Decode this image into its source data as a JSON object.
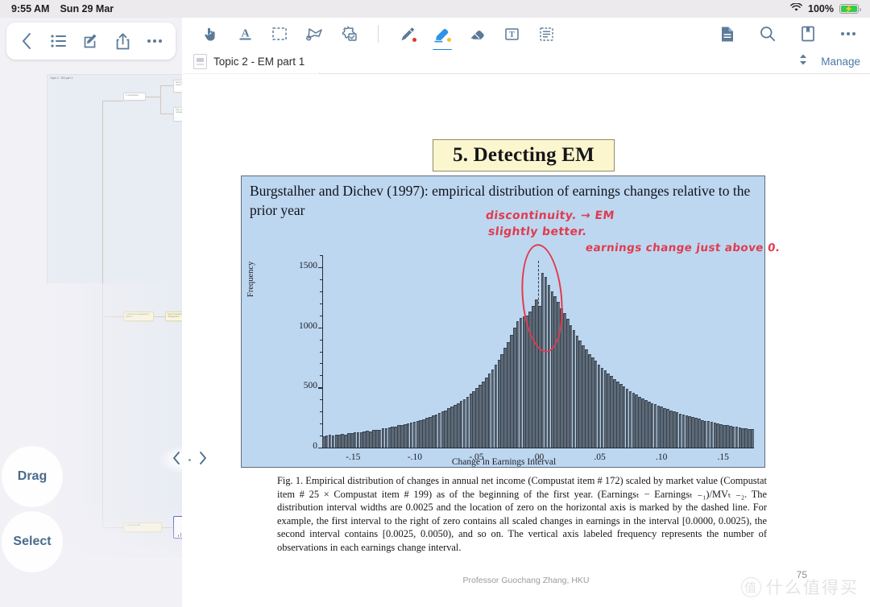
{
  "statusbar": {
    "time": "9:55 AM",
    "date": "Sun 29 Mar",
    "wifi_icon": "wifi-icon",
    "battery_percent": "100%",
    "battery_icon": "battery-charging-icon"
  },
  "left_toolbar": {
    "items": [
      {
        "name": "back-button",
        "icon": "chevron-left-icon"
      },
      {
        "name": "list-button",
        "icon": "bulleted-list-icon"
      },
      {
        "name": "edit-button",
        "icon": "compose-icon"
      },
      {
        "name": "share-button",
        "icon": "share-icon"
      },
      {
        "name": "more-button",
        "icon": "ellipsis-icon"
      }
    ]
  },
  "left_panel": {
    "mindmap_title": "Topic 2 - EM part 1",
    "drag_label": "Drag",
    "select_label": "Select",
    "nav_prev_icon": "chevron-left-icon",
    "nav_next_icon": "chevron-right-icon"
  },
  "doc_toolbar": {
    "left_tools": [
      {
        "name": "hand-tool",
        "icon": "hand-pointer-icon",
        "active": false
      },
      {
        "name": "text-underline-tool",
        "icon": "text-underline-icon",
        "active": false
      },
      {
        "name": "select-rectangle-tool",
        "icon": "selection-rectangle-icon",
        "active": false
      },
      {
        "name": "lasso-tool",
        "icon": "lasso-icon",
        "active": false
      },
      {
        "name": "shape-tool",
        "icon": "shape-settings-icon",
        "active": false
      },
      {
        "name": "pen-tool",
        "icon": "pen-icon",
        "active": false,
        "color": "#e5342f"
      },
      {
        "name": "highlighter-tool",
        "icon": "highlighter-icon",
        "active": true,
        "color": "#f2c230"
      },
      {
        "name": "eraser-tool",
        "icon": "eraser-icon",
        "active": false
      },
      {
        "name": "text-box-tool",
        "icon": "text-box-icon",
        "active": false
      },
      {
        "name": "note-tool",
        "icon": "sticky-note-icon",
        "active": false
      }
    ],
    "right_tools": [
      {
        "name": "page-view-button",
        "icon": "document-page-icon"
      },
      {
        "name": "search-button",
        "icon": "search-icon"
      },
      {
        "name": "bookmark-button",
        "icon": "bookmark-icon"
      },
      {
        "name": "more-options-button",
        "icon": "ellipsis-icon"
      }
    ]
  },
  "tabbar": {
    "tabs": [
      {
        "label": "Topic 2 - EM part 1",
        "thumb_icon": "document-thumbnail-icon"
      }
    ],
    "sort_icon": "up-down-chevron-icon",
    "manage_label": "Manage"
  },
  "slide": {
    "title": "5. Detecting EM",
    "headline": "Burgstalher and Dichev (1997): empirical distribution of earnings changes relative to the prior year",
    "annotations": [
      "discontinuity. → EM",
      "slightly better.",
      "earnings change just above 0."
    ],
    "caption": "Fig. 1.  Empirical distribution of changes in annual net income (Compustat item  # 172) scaled by market value (Compustat item  # 25 × Compustat item  # 199) as of the beginning of the first year. (Earningsₜ − Earningsₜ ₋₁)/MVₜ ₋₂. The distribution interval widths are 0.0025 and the location of zero on the horizontal axis is marked by the dashed line. For example, the first interval to the right of zero contains all scaled changes in earnings in the interval [0.0000, 0.0025), the second interval contains [0.0025, 0.0050), and so on. The vertical axis labeled frequency represents the number of observations in each earnings change interval.",
    "footer": "Professor Guochang Zhang, HKU",
    "page_number": "75"
  },
  "watermark": {
    "mark": "值",
    "text": "什么值得买"
  },
  "chart_data": {
    "type": "bar",
    "title": "",
    "xlabel": "Change in Earnings Interval",
    "ylabel": "Frequency",
    "xticks": [
      "-.15",
      "-.10",
      "-.05",
      ".00",
      ".05",
      ".10",
      ".15"
    ],
    "xtick_values": [
      -0.15,
      -0.1,
      -0.05,
      0.0,
      0.05,
      0.1,
      0.15
    ],
    "yticks": [
      "0",
      "500",
      "1000",
      "1500"
    ],
    "ytick_values": [
      0,
      500,
      1000,
      1500
    ],
    "xlim": [
      -0.175,
      0.175
    ],
    "ylim": [
      0,
      1600
    ],
    "grid": false,
    "legend": false,
    "zero_marker": "dashed line at x = 0.00",
    "bin_width": 0.0025,
    "x": [
      -0.1725,
      -0.17,
      -0.1675,
      -0.165,
      -0.1625,
      -0.16,
      -0.1575,
      -0.155,
      -0.1525,
      -0.15,
      -0.1475,
      -0.145,
      -0.1425,
      -0.14,
      -0.1375,
      -0.135,
      -0.1325,
      -0.13,
      -0.1275,
      -0.125,
      -0.1225,
      -0.12,
      -0.1175,
      -0.115,
      -0.1125,
      -0.11,
      -0.1075,
      -0.105,
      -0.1025,
      -0.1,
      -0.0975,
      -0.095,
      -0.0925,
      -0.09,
      -0.0875,
      -0.085,
      -0.0825,
      -0.08,
      -0.0775,
      -0.075,
      -0.0725,
      -0.07,
      -0.0675,
      -0.065,
      -0.0625,
      -0.06,
      -0.0575,
      -0.055,
      -0.0525,
      -0.05,
      -0.0475,
      -0.045,
      -0.0425,
      -0.04,
      -0.0375,
      -0.035,
      -0.0325,
      -0.03,
      -0.0275,
      -0.025,
      -0.0225,
      -0.02,
      -0.0175,
      -0.015,
      -0.0125,
      -0.01,
      -0.0075,
      -0.005,
      -0.0025,
      0.0,
      0.0025,
      0.005,
      0.0075,
      0.01,
      0.0125,
      0.015,
      0.0175,
      0.02,
      0.0225,
      0.025,
      0.0275,
      0.03,
      0.0325,
      0.035,
      0.0375,
      0.04,
      0.0425,
      0.045,
      0.0475,
      0.05,
      0.0525,
      0.055,
      0.0575,
      0.06,
      0.0625,
      0.065,
      0.0675,
      0.07,
      0.0725,
      0.075,
      0.0775,
      0.08,
      0.0825,
      0.085,
      0.0875,
      0.09,
      0.0925,
      0.095,
      0.0975,
      0.1,
      0.1025,
      0.105,
      0.1075,
      0.11,
      0.1125,
      0.115,
      0.1175,
      0.12,
      0.1225,
      0.125,
      0.1275,
      0.13,
      0.1325,
      0.135,
      0.1375,
      0.14,
      0.1425,
      0.145,
      0.1475,
      0.15,
      0.1525,
      0.155,
      0.1575,
      0.16,
      0.1625,
      0.165,
      0.1675,
      0.17
    ],
    "values": [
      95,
      100,
      105,
      100,
      110,
      105,
      115,
      110,
      120,
      120,
      125,
      130,
      125,
      135,
      140,
      135,
      145,
      150,
      150,
      160,
      160,
      170,
      175,
      175,
      185,
      190,
      195,
      200,
      210,
      215,
      220,
      230,
      235,
      245,
      255,
      265,
      275,
      285,
      300,
      310,
      325,
      340,
      355,
      370,
      390,
      405,
      425,
      450,
      470,
      495,
      520,
      550,
      580,
      615,
      650,
      690,
      730,
      780,
      830,
      880,
      940,
      1000,
      1050,
      1080,
      1090,
      1095,
      1130,
      1180,
      1230,
      1180,
      1450,
      1420,
      1350,
      1300,
      1260,
      1210,
      1160,
      1120,
      1070,
      1020,
      980,
      930,
      890,
      850,
      820,
      780,
      750,
      720,
      690,
      660,
      640,
      615,
      595,
      570,
      550,
      530,
      510,
      490,
      470,
      455,
      440,
      425,
      410,
      395,
      385,
      370,
      360,
      350,
      340,
      330,
      320,
      310,
      300,
      292,
      284,
      276,
      268,
      260,
      252,
      245,
      238,
      230,
      224,
      218,
      212,
      206,
      200,
      195,
      190,
      185,
      180,
      176,
      172,
      168,
      164,
      160,
      156,
      152
    ]
  }
}
